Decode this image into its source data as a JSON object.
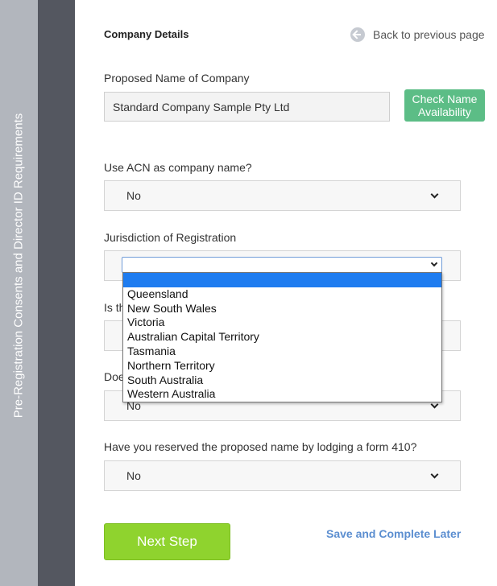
{
  "sidebar": {
    "steps_label": "Pre-Registration Consents and Director ID Requirements",
    "current_label": "Company Details"
  },
  "header": {
    "title": "Company Details",
    "back_label": "Back to previous page"
  },
  "form": {
    "company_name": {
      "label": "Proposed Name of Company",
      "value": "Standard Company Sample Pty Ltd",
      "check_button": "Check Name Availability"
    },
    "use_acn": {
      "label": "Use ACN as company name?",
      "value": "No"
    },
    "jurisdiction": {
      "label": "Jurisdiction of Registration",
      "value": "",
      "options": [
        "",
        "Queensland",
        "New South Wales",
        "Victoria",
        "Australian Capital Territory",
        "Tasmania",
        "Northern Territory",
        "South Australia",
        "Western Australia"
      ],
      "highlighted_index": 0
    },
    "q4": {
      "label_visible": "Is th",
      "value": ""
    },
    "q5": {
      "label_visible": "Doe",
      "value": "No"
    },
    "reserved_name": {
      "label": "Have you reserved the proposed name by lodging a form 410?",
      "value": "No"
    }
  },
  "actions": {
    "next_step": "Next Step",
    "save_later": "Save and Complete Later"
  },
  "colors": {
    "sidebar_light": "#b2b6bd",
    "sidebar_dark": "#545760",
    "check_button": "#5cbd86",
    "next_button": "#8fd32e",
    "link": "#5b8ed0",
    "highlight": "#1e7cf0"
  },
  "icons": {
    "back": "back-arrow-circle-icon",
    "select": "chevron-down-icon"
  }
}
